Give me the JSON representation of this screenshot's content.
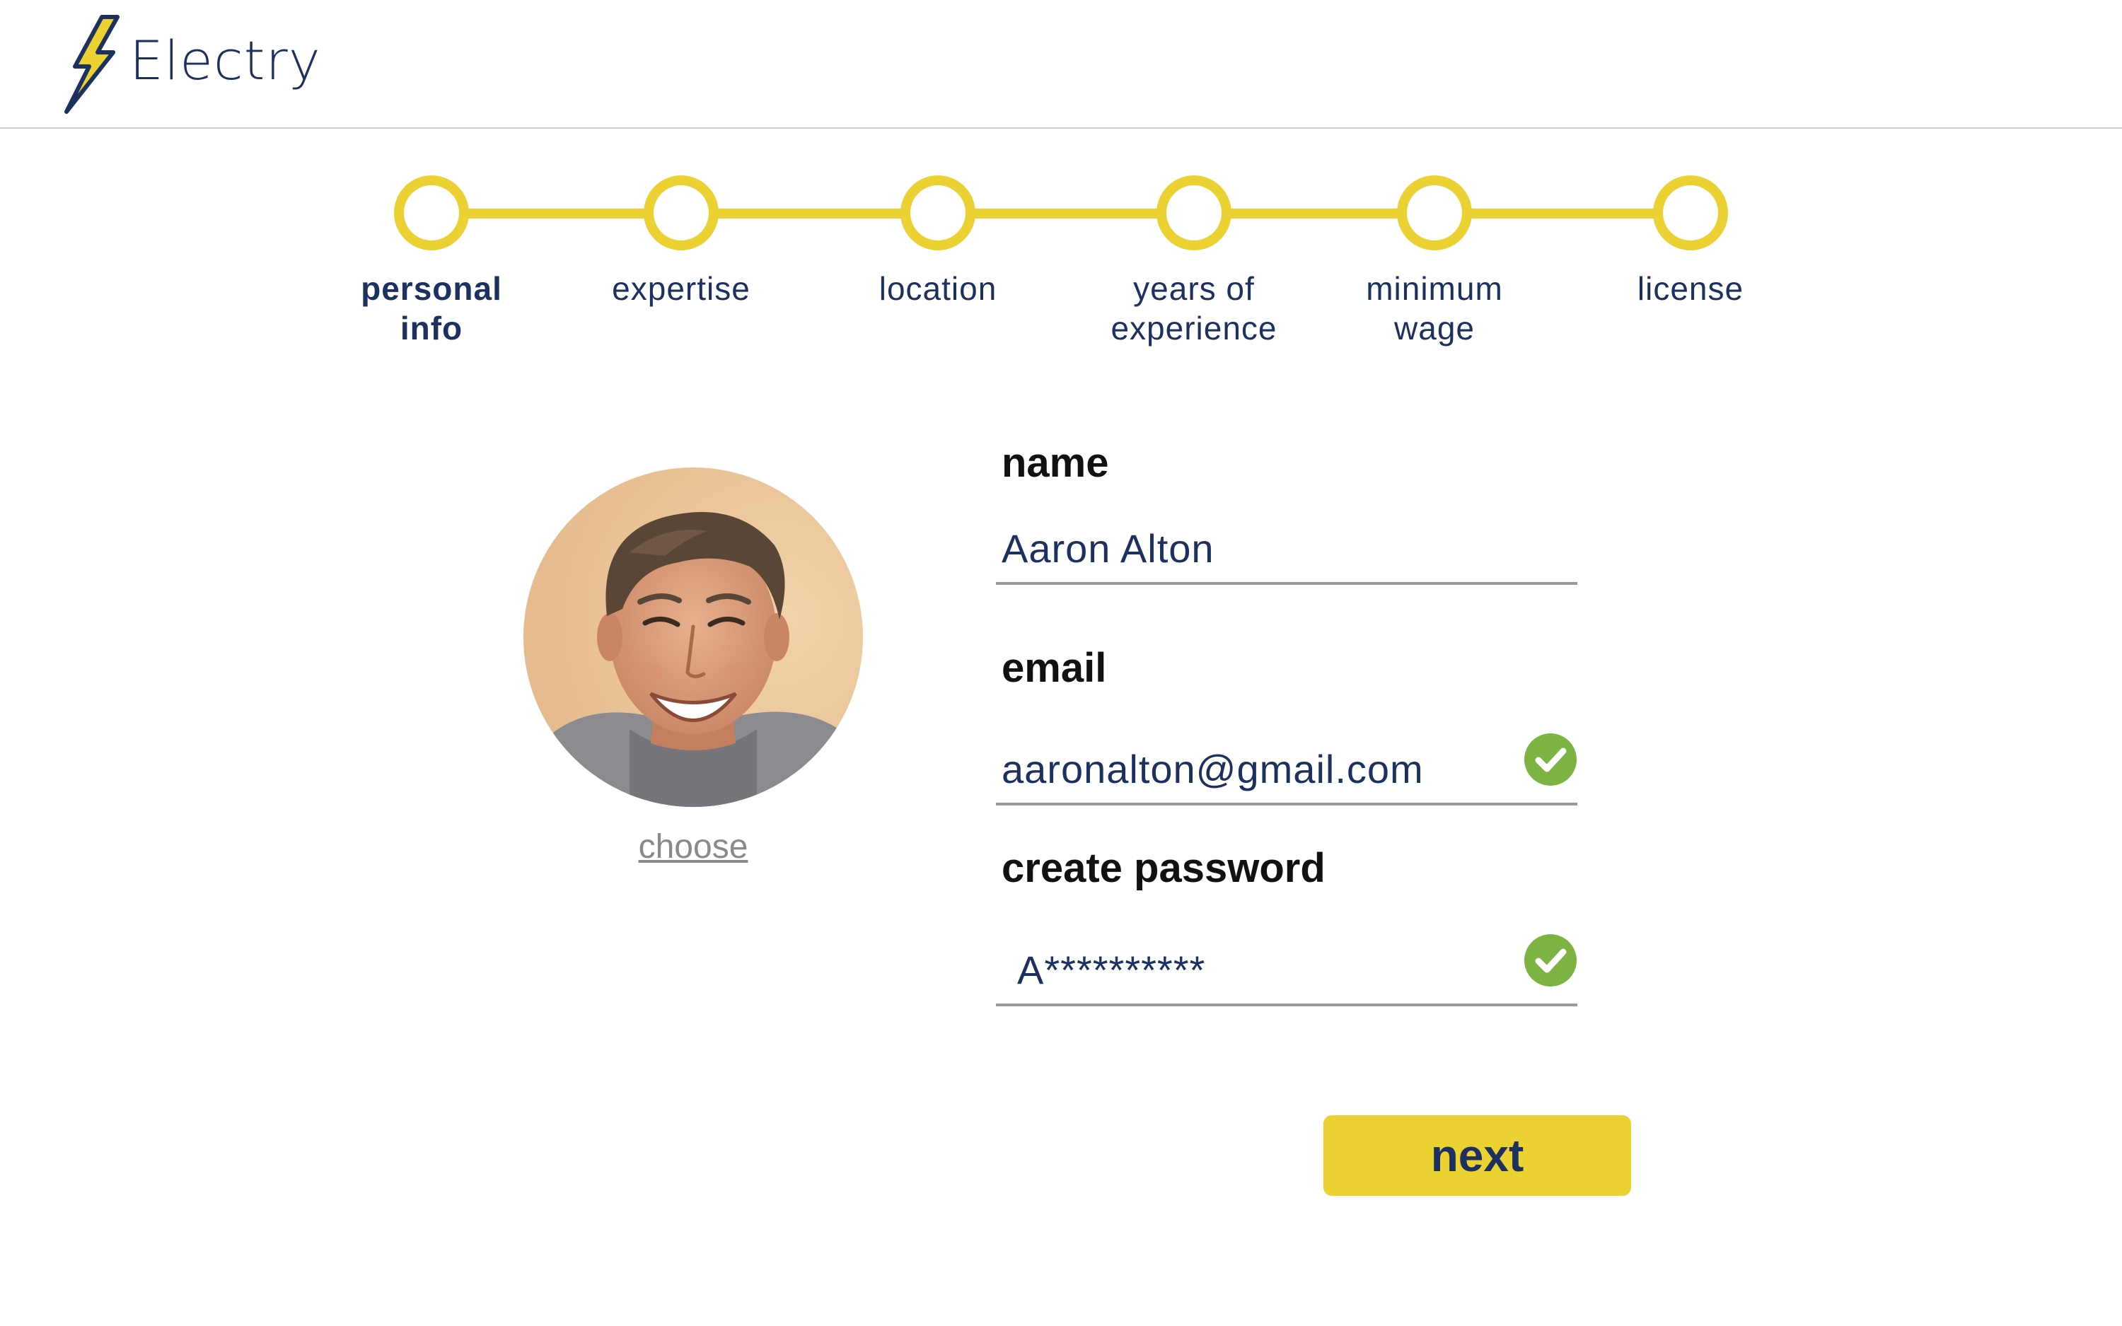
{
  "app": {
    "name": "Electry",
    "logo_icon": "lightning-bolt-icon"
  },
  "stepper": {
    "steps": [
      {
        "label": "personal\ninfo",
        "active": true
      },
      {
        "label": "expertise",
        "active": false
      },
      {
        "label": "location",
        "active": false
      },
      {
        "label": "years of\nexperience",
        "active": false
      },
      {
        "label": "minimum\nwage",
        "active": false
      },
      {
        "label": "license",
        "active": false
      }
    ]
  },
  "profile": {
    "avatar_alt": "profile photo",
    "choose_label": "choose"
  },
  "form": {
    "name": {
      "label": "name",
      "value": "Aaron Alton"
    },
    "email": {
      "label": "email",
      "value": "aaronalton@gmail.com",
      "valid": true,
      "status_icon": "check-circle-icon"
    },
    "password": {
      "label": "create password",
      "value": "A**********",
      "valid": true,
      "status_icon": "check-circle-icon"
    }
  },
  "actions": {
    "next_label": "next"
  },
  "colors": {
    "brand_navy": "#1d3160",
    "accent_yellow": "#ecd132",
    "valid_green": "#7cb342",
    "divider_gray": "#cfcfcf"
  }
}
